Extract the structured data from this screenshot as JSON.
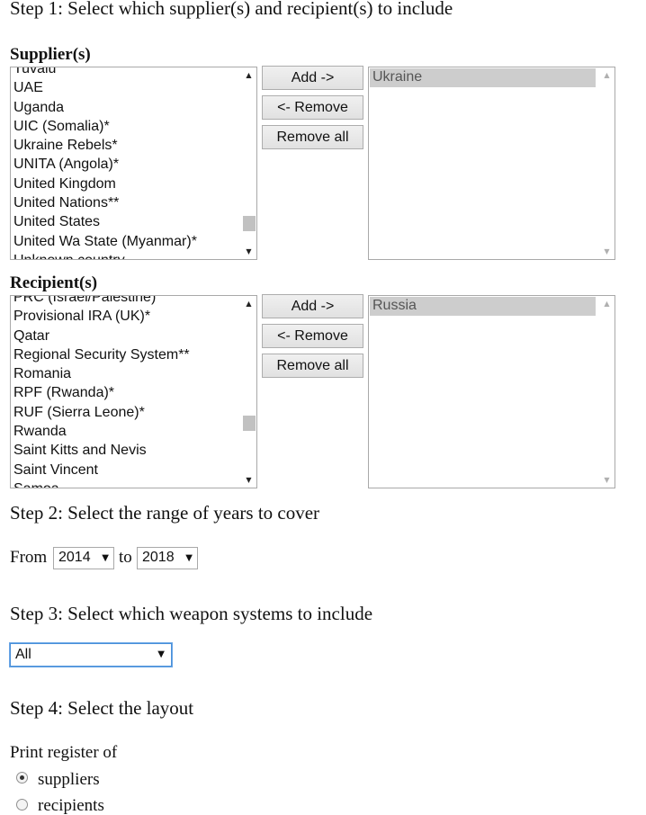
{
  "step1": {
    "heading": "Step 1: Select which supplier(s) and recipient(s) to include",
    "suppliers": {
      "label": "Supplier(s)",
      "available": [
        "Tuvalu",
        "UAE",
        "Uganda",
        "UIC (Somalia)*",
        "Ukraine Rebels*",
        "UNITA (Angola)*",
        "United Kingdom",
        "United Nations**",
        "United States",
        "United Wa State (Myanmar)*",
        "Unknown country"
      ],
      "selected": [
        "Ukraine"
      ],
      "add_label": "Add ->",
      "remove_label": "<- Remove",
      "remove_all_label": "Remove all"
    },
    "recipients": {
      "label": "Recipient(s)",
      "available": [
        "PRC (Israel/Palestine)",
        "Provisional IRA (UK)*",
        "Qatar",
        "Regional Security System**",
        "Romania",
        "RPF (Rwanda)*",
        "RUF (Sierra Leone)*",
        "Rwanda",
        "Saint Kitts and Nevis",
        "Saint Vincent",
        "Samoa"
      ],
      "selected": [
        "Russia"
      ],
      "add_label": "Add ->",
      "remove_label": "<- Remove",
      "remove_all_label": "Remove all"
    }
  },
  "step2": {
    "heading": "Step 2: Select the range of years to cover",
    "from_label": "From",
    "from_value": "2014",
    "to_label": "to",
    "to_value": "2018"
  },
  "step3": {
    "heading": "Step 3: Select which weapon systems to include",
    "weapon_value": "All"
  },
  "step4": {
    "heading": "Step 4: Select the layout",
    "print_label": "Print register of",
    "options": [
      {
        "label": "suppliers",
        "checked": true
      },
      {
        "label": "recipients",
        "checked": false
      }
    ]
  },
  "icons": {
    "scroll_up": "▲",
    "scroll_down": "▼",
    "dropdown": "▼"
  }
}
